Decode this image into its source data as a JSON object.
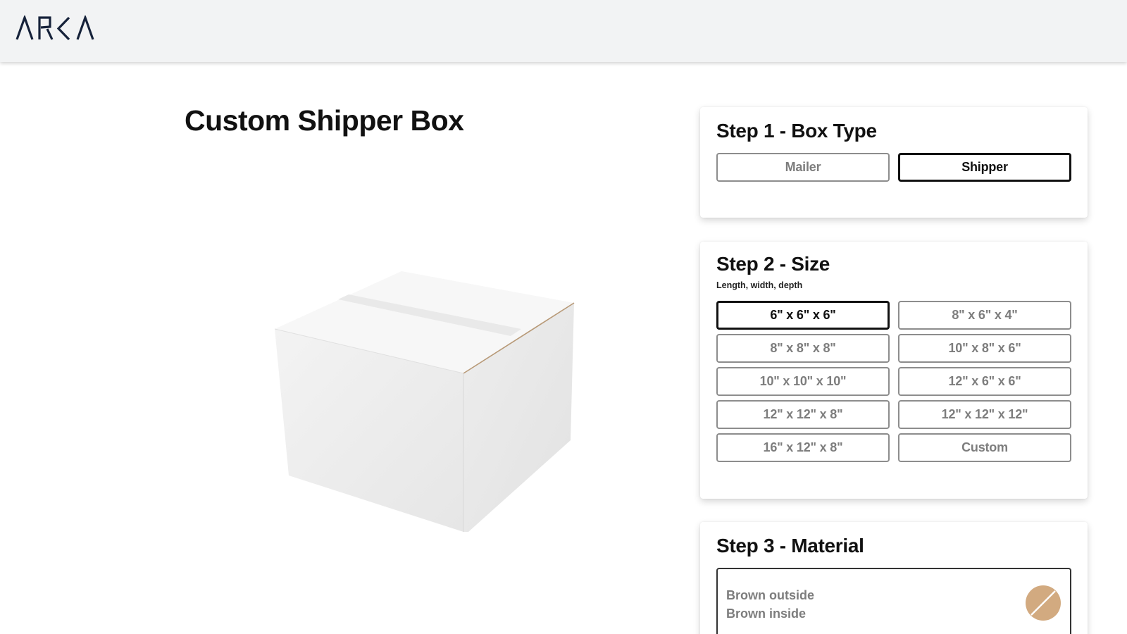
{
  "brand": {
    "name": "ARKA"
  },
  "page": {
    "title": "Custom Shipper Box"
  },
  "step1": {
    "title": "Step 1 - Box Type",
    "options": [
      {
        "label": "Mailer",
        "selected": false
      },
      {
        "label": "Shipper",
        "selected": true
      }
    ]
  },
  "step2": {
    "title": "Step 2 - Size",
    "subtitle": "Length, width, depth",
    "options": [
      {
        "label": "6\" x 6\" x 6\"",
        "selected": true
      },
      {
        "label": "8\" x 6\" x 4\"",
        "selected": false
      },
      {
        "label": "8\" x 8\" x 8\"",
        "selected": false
      },
      {
        "label": "10\" x 8\" x 6\"",
        "selected": false
      },
      {
        "label": "10\" x 10\" x 10\"",
        "selected": false
      },
      {
        "label": "12\" x 6\" x 6\"",
        "selected": false
      },
      {
        "label": "12\" x 12\" x 8\"",
        "selected": false
      },
      {
        "label": "12\" x 12\" x 12\"",
        "selected": false
      },
      {
        "label": "16\" x 12\" x 8\"",
        "selected": false
      },
      {
        "label": "Custom",
        "selected": false
      }
    ]
  },
  "step3": {
    "title": "Step 3 - Material",
    "options": [
      {
        "line1": "Brown outside",
        "line2": "Brown inside",
        "swatch_icon": "kraft-color-swatch-icon",
        "swatch_color": "#d2aa80"
      }
    ]
  },
  "colors": {
    "header_bg": "#f2f3f4",
    "logo": "#16223a",
    "selected_border": "#111111",
    "unselected_border": "#8d8d8d",
    "unselected_text": "#7d7d7d"
  }
}
